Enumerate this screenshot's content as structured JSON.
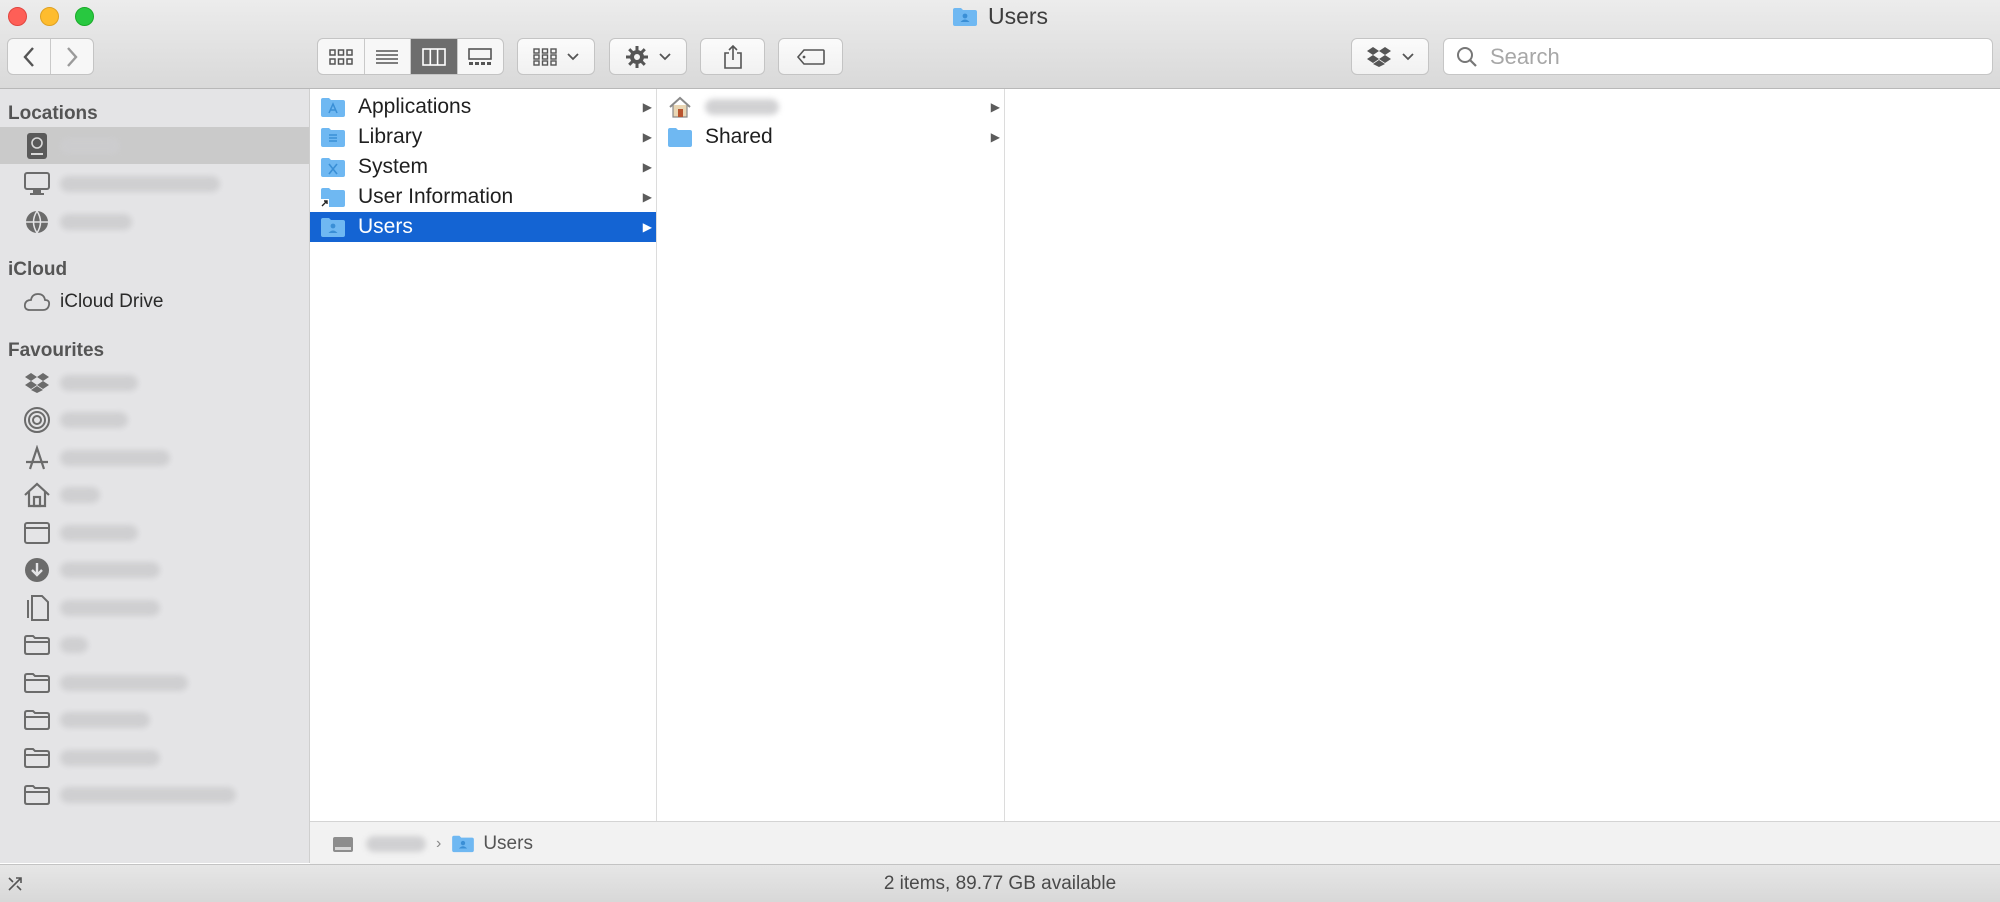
{
  "window": {
    "title": "Users"
  },
  "toolbar": {
    "back_icon": "chevron-left-icon",
    "forward_icon": "chevron-right-icon",
    "search_placeholder": "Search"
  },
  "sidebar": {
    "sections": [
      {
        "heading": "Locations"
      },
      {
        "heading": "iCloud"
      },
      {
        "heading": "Favourites"
      }
    ],
    "icloud_drive": "iCloud Drive"
  },
  "columns": {
    "col1": [
      {
        "label": "Applications"
      },
      {
        "label": "Library"
      },
      {
        "label": "System"
      },
      {
        "label": "User Information"
      },
      {
        "label": "Users"
      }
    ],
    "col2": [
      {
        "label": ""
      },
      {
        "label": "Shared"
      }
    ]
  },
  "pathbar": {
    "current": "Users"
  },
  "status": {
    "text": "2 items, 89.77 GB available"
  },
  "colors": {
    "selection": "#1464d3",
    "folder": "#6fb8f2"
  }
}
